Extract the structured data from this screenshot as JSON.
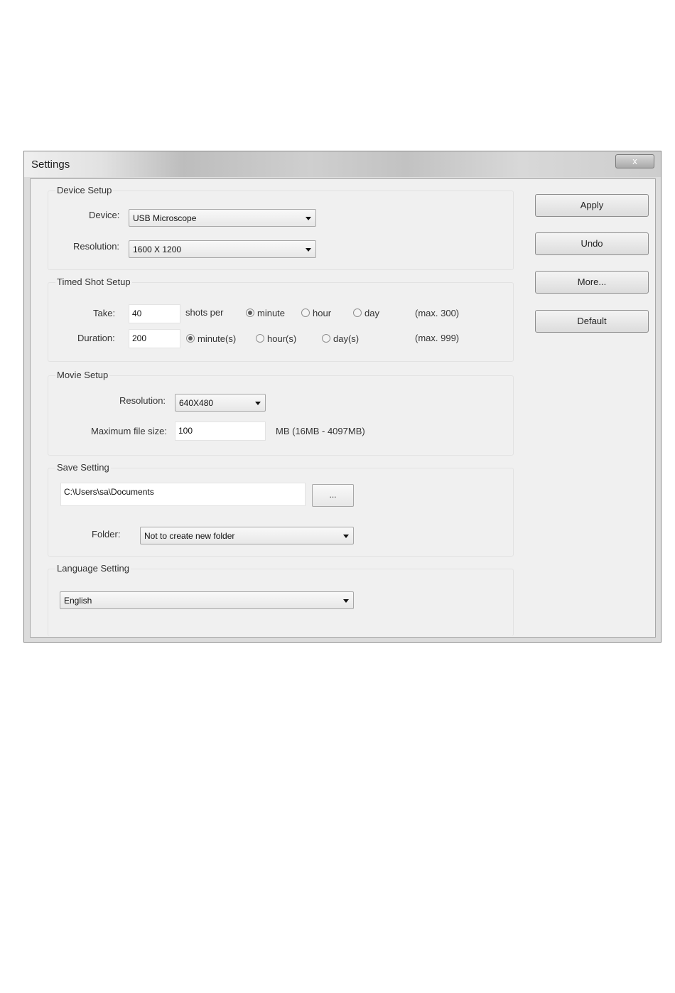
{
  "window": {
    "title": "Settings",
    "close_label": "x"
  },
  "device_setup": {
    "legend": "Device Setup",
    "device_label": "Device:",
    "device_value": "USB Microscope",
    "resolution_label": "Resolution:",
    "resolution_value": "1600 X 1200"
  },
  "timed_shot": {
    "legend": "Timed Shot Setup",
    "take_label": "Take:",
    "take_value": "40",
    "shots_per_label": "shots per",
    "per_options": [
      {
        "label": "minute",
        "selected": true
      },
      {
        "label": "hour",
        "selected": false
      },
      {
        "label": "day",
        "selected": false
      }
    ],
    "take_max": "(max. 300)",
    "duration_label": "Duration:",
    "duration_value": "200",
    "duration_options": [
      {
        "label": "minute(s)",
        "selected": true
      },
      {
        "label": "hour(s)",
        "selected": false
      },
      {
        "label": "day(s)",
        "selected": false
      }
    ],
    "duration_max": "(max. 999)"
  },
  "movie_setup": {
    "legend": "Movie Setup",
    "resolution_label": "Resolution:",
    "resolution_value": "640X480",
    "max_size_label": "Maximum file size:",
    "max_size_value": "100",
    "max_size_range": "MB (16MB - 4097MB)"
  },
  "save_setting": {
    "legend": "Save Setting",
    "path_value": "C:\\Users\\sa\\Documents",
    "browse_label": "...",
    "folder_label": "Folder:",
    "folder_value": "Not to create new folder"
  },
  "language_setting": {
    "legend": "Language Setting",
    "language_value": "English"
  },
  "buttons": {
    "apply": "Apply",
    "undo": "Undo",
    "more": "More...",
    "default": "Default"
  }
}
